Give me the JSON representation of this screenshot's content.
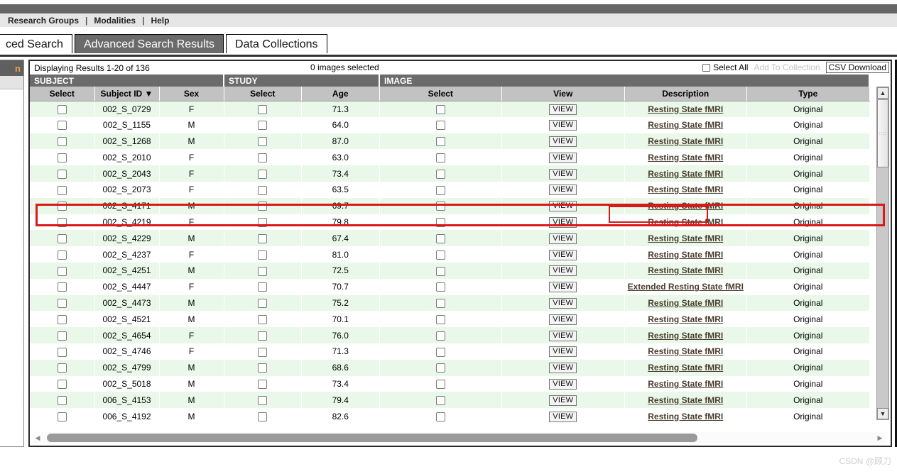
{
  "nav": {
    "items": [
      {
        "label": "Research Groups"
      },
      {
        "label": "Modalities"
      },
      {
        "label": "Help"
      }
    ],
    "separator": "|"
  },
  "tabs": [
    {
      "label": "ced Search",
      "active": false
    },
    {
      "label": "Advanced Search Results",
      "active": true
    },
    {
      "label": "Data Collections",
      "active": false
    }
  ],
  "sidebar": {
    "header_label": "n"
  },
  "toolbar": {
    "results_text": "Displaying Results 1-20 of 136",
    "selected_text": "0 images selected",
    "select_all_label": "Select All",
    "add_to_collection_label": "Add To Collection",
    "csv_download_label": "CSV Download"
  },
  "table": {
    "group_headers": [
      {
        "label": "SUBJECT",
        "span": 3
      },
      {
        "label": "STUDY",
        "span": 2
      },
      {
        "label": "IMAGE",
        "span": 4
      }
    ],
    "columns": [
      {
        "label": "Select"
      },
      {
        "label": "Subject ID ▼"
      },
      {
        "label": "Sex"
      },
      {
        "label": "Select"
      },
      {
        "label": "Age"
      },
      {
        "label": "Select"
      },
      {
        "label": "View"
      },
      {
        "label": "Description"
      },
      {
        "label": "Type"
      }
    ],
    "view_button_label": "VIEW",
    "rows": [
      {
        "subject_id": "002_S_0729",
        "sex": "F",
        "age": "71.3",
        "view": "VIEW",
        "description": "Resting State fMRI",
        "type": "Original"
      },
      {
        "subject_id": "002_S_1155",
        "sex": "M",
        "age": "64.0",
        "view": "VIEW",
        "description": "Resting State fMRI",
        "type": "Original"
      },
      {
        "subject_id": "002_S_1268",
        "sex": "M",
        "age": "87.0",
        "view": "VIEW",
        "description": "Resting State fMRI",
        "type": "Original"
      },
      {
        "subject_id": "002_S_2010",
        "sex": "F",
        "age": "63.0",
        "view": "VIEW",
        "description": "Resting State fMRI",
        "type": "Original"
      },
      {
        "subject_id": "002_S_2043",
        "sex": "F",
        "age": "73.4",
        "view": "VIEW",
        "description": "Resting State fMRI",
        "type": "Original"
      },
      {
        "subject_id": "002_S_2073",
        "sex": "F",
        "age": "63.5",
        "view": "VIEW",
        "description": "Resting State fMRI",
        "type": "Original"
      },
      {
        "subject_id": "002_S_4171",
        "sex": "M",
        "age": "69.7",
        "view": "VIEW",
        "description": "Resting State fMRI",
        "type": "Original"
      },
      {
        "subject_id": "002_S_4219",
        "sex": "F",
        "age": "79.8",
        "view": "VIEW",
        "description": "Resting State fMRI",
        "type": "Original"
      },
      {
        "subject_id": "002_S_4229",
        "sex": "M",
        "age": "67.4",
        "view": "VIEW",
        "description": "Resting State fMRI",
        "type": "Original"
      },
      {
        "subject_id": "002_S_4237",
        "sex": "F",
        "age": "81.0",
        "view": "VIEW",
        "description": "Resting State fMRI",
        "type": "Original"
      },
      {
        "subject_id": "002_S_4251",
        "sex": "M",
        "age": "72.5",
        "view": "VIEW",
        "description": "Resting State fMRI",
        "type": "Original"
      },
      {
        "subject_id": "002_S_4447",
        "sex": "F",
        "age": "70.7",
        "view": "VIEW",
        "description": "Extended Resting State fMRI",
        "type": "Original"
      },
      {
        "subject_id": "002_S_4473",
        "sex": "M",
        "age": "75.2",
        "view": "VIEW",
        "description": "Resting State fMRI",
        "type": "Original"
      },
      {
        "subject_id": "002_S_4521",
        "sex": "M",
        "age": "70.1",
        "view": "VIEW",
        "description": "Resting State fMRI",
        "type": "Original"
      },
      {
        "subject_id": "002_S_4654",
        "sex": "F",
        "age": "76.0",
        "view": "VIEW",
        "description": "Resting State fMRI",
        "type": "Original"
      },
      {
        "subject_id": "002_S_4746",
        "sex": "F",
        "age": "71.3",
        "view": "VIEW",
        "description": "Resting State fMRI",
        "type": "Original"
      },
      {
        "subject_id": "002_S_4799",
        "sex": "M",
        "age": "68.6",
        "view": "VIEW",
        "description": "Resting State fMRI",
        "type": "Original"
      },
      {
        "subject_id": "002_S_5018",
        "sex": "M",
        "age": "73.4",
        "view": "VIEW",
        "description": "Resting State fMRI",
        "type": "Original"
      },
      {
        "subject_id": "006_S_4153",
        "sex": "M",
        "age": "79.4",
        "view": "VIEW",
        "description": "Resting State fMRI",
        "type": "Original"
      },
      {
        "subject_id": "006_S_4192",
        "sex": "M",
        "age": "82.6",
        "view": "VIEW",
        "description": "Resting State fMRI",
        "type": "Original"
      }
    ]
  },
  "annotation": {
    "highlighted_row_index": 6,
    "color": "#d81919"
  },
  "watermark": {
    "text": "CSDN @顾刀"
  },
  "colors": {
    "group_header_bg": "#6b6b6b",
    "column_header_bg": "#c2c2c2",
    "row_even_bg": "#e9f8e9",
    "row_odd_bg": "#ffffff",
    "link": "#4a3d2f",
    "annotation": "#d81919"
  }
}
